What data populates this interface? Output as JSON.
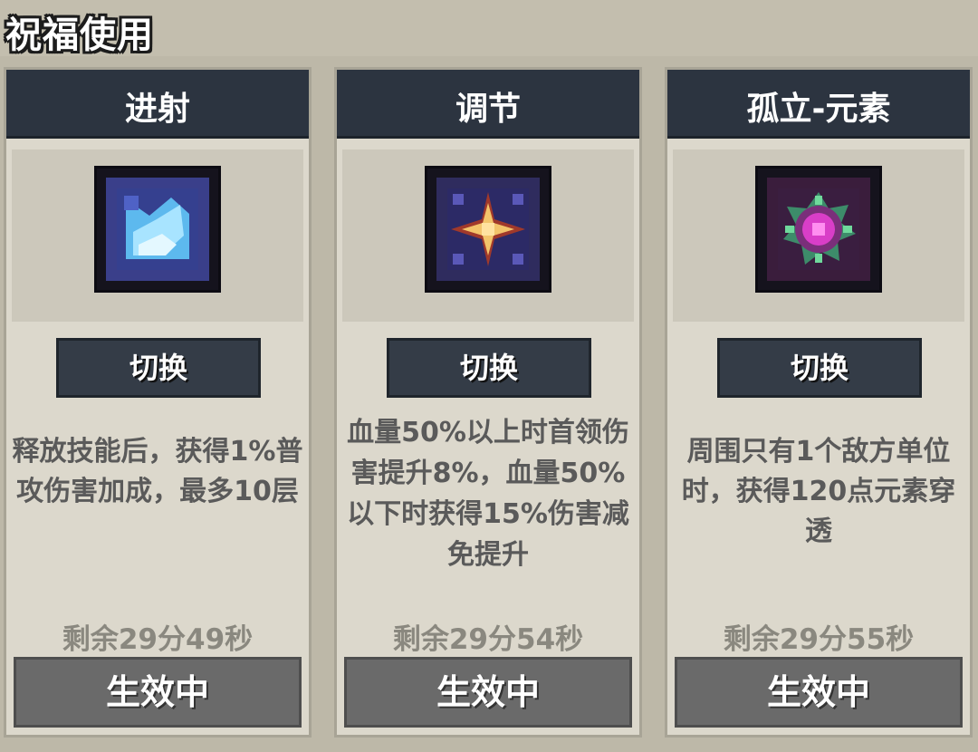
{
  "header": {
    "title": "祝福使用"
  },
  "cards": [
    {
      "title": "进射",
      "icon": "dash-shard-icon",
      "switch_label": "切换",
      "description": "释放技能后，获得1%普攻伤害加成，最多10层",
      "remaining": "剩余29分49秒",
      "status": "生效中",
      "accent": "#8fd3ff"
    },
    {
      "title": "调节",
      "icon": "sun-star-icon",
      "switch_label": "切换",
      "description": "血量50%以上时首领伤害提升8%，血量50%以下时获得15%伤害减免提升",
      "remaining": "剩余29分54秒",
      "status": "生效中",
      "accent": "#f0c050"
    },
    {
      "title": "孤立-元素",
      "icon": "element-orb-icon",
      "switch_label": "切换",
      "description": "周围只有1个敌方单位时，获得120点元素穿透",
      "remaining": "剩余29分55秒",
      "status": "生效中",
      "accent": "#e040d0"
    }
  ]
}
